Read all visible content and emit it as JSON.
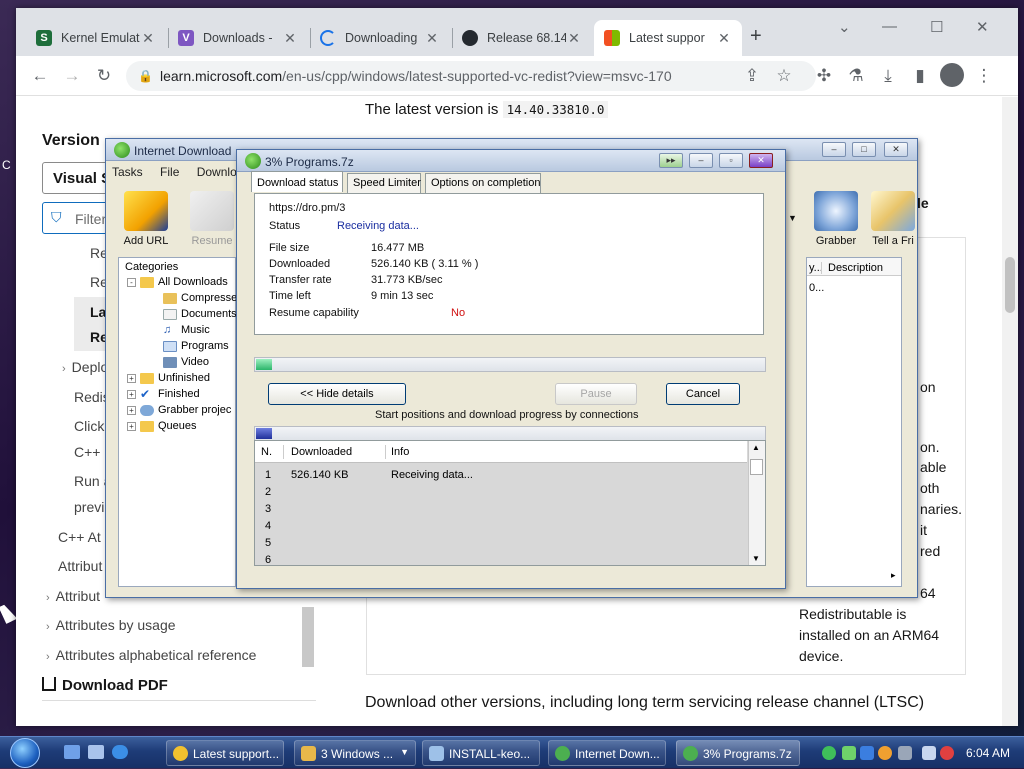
{
  "desktop": {
    "left_glyph": "C"
  },
  "browser": {
    "tabs": [
      {
        "title": "Kernel Emulat",
        "icon": "s-icon",
        "color": "#1e6e3b",
        "glyph": "S"
      },
      {
        "title": "Downloads - ",
        "icon": "vs-icon",
        "color": "#7e57c2",
        "glyph": "V"
      },
      {
        "title": "Downloading",
        "icon": "spinner-icon",
        "color": "#1a73e8",
        "glyph": ""
      },
      {
        "title": "Release 68.14",
        "icon": "github-icon",
        "color": "#24292f",
        "glyph": ""
      },
      {
        "title": "Latest suppor",
        "icon": "microsoft-icon",
        "color": "#f25022",
        "glyph": ""
      }
    ],
    "url_host": "learn.microsoft.com",
    "url_path": "/en-us/cpp/windows/latest-supported-vc-redist?view=msvc-170"
  },
  "page": {
    "latest_prefix": "The latest version is",
    "latest_version": "14.40.33810.0",
    "version_heading": "Version",
    "version_button": "Visual S",
    "filter_placeholder": "Filter",
    "nav": [
      {
        "label": "Re",
        "bold": false
      },
      {
        "label": "Re",
        "bold": false
      },
      {
        "label": "La",
        "bold": true
      },
      {
        "label": "Re",
        "bold": true
      },
      {
        "label": "Deplo",
        "bold": false,
        "chevron": true
      },
      {
        "label": "Redis",
        "bold": false
      },
      {
        "label": "ClickO",
        "bold": false
      },
      {
        "label": "C++",
        "bold": false
      },
      {
        "label": "Run a",
        "bold": false
      },
      {
        "label": "previ",
        "bold": false
      },
      {
        "label": "C++ At",
        "bold": false
      },
      {
        "label": "Attribut",
        "bold": false
      },
      {
        "label": "Attribut",
        "bold": false,
        "chevron": true
      },
      {
        "label": "Attributes by usage",
        "bold": false,
        "chevron": true
      },
      {
        "label": "Attributes alphabetical reference",
        "bold": false,
        "chevron": true
      }
    ],
    "download_pdf": "Download PDF",
    "table_heading_fragment": "table",
    "right_fragments": [
      "on",
      "on.",
      "able",
      "oth",
      "naries.",
      "it",
      "red",
      "64"
    ],
    "redist_text": [
      "Redistributable is",
      "installed on an ARM64",
      "device."
    ],
    "download_other": "Download other versions, including long term servicing release channel (LTSC)"
  },
  "idm": {
    "title": "Internet Download",
    "menu": [
      "Tasks",
      "File",
      "Downlo"
    ],
    "toolbar": [
      {
        "label": "Add URL"
      },
      {
        "label": "Resume"
      },
      {
        "label": "Grabber"
      },
      {
        "label": "Tell a Fri"
      }
    ],
    "categories_label": "Categories",
    "categories": [
      {
        "label": "All Downloads",
        "level": 0,
        "expand": "-"
      },
      {
        "label": "Compresse",
        "level": 1
      },
      {
        "label": "Documents",
        "level": 1
      },
      {
        "label": "Music",
        "level": 1
      },
      {
        "label": "Programs",
        "level": 1
      },
      {
        "label": "Video",
        "level": 1
      },
      {
        "label": "Unfinished",
        "level": 0,
        "expand": "+"
      },
      {
        "label": "Finished",
        "level": 0,
        "expand": "+"
      },
      {
        "label": "Grabber projec",
        "level": 0,
        "expand": "+"
      },
      {
        "label": "Queues",
        "level": 0,
        "expand": "+"
      }
    ],
    "list_columns": [
      "y...",
      "Description"
    ],
    "list_row_fragment": "0..."
  },
  "progress": {
    "title": "3% Programs.7z",
    "tabs": [
      "Download status",
      "Speed Limiter",
      "Options on completion"
    ],
    "url": "https://dro.pm/3",
    "status_label": "Status",
    "status_value": "Receiving data...",
    "fields": [
      {
        "label": "File size",
        "value": "16.477  MB"
      },
      {
        "label": "Downloaded",
        "value": "526.140  KB  ( 3.11 % )"
      },
      {
        "label": "Transfer rate",
        "value": "31.773  KB/sec"
      },
      {
        "label": "Time left",
        "value": "9 min 13 sec"
      }
    ],
    "resume_label": "Resume capability",
    "resume_value": "No",
    "progress_fraction": 0.0311,
    "buttons": {
      "hide": "<< Hide details",
      "pause": "Pause",
      "cancel": "Cancel"
    },
    "connections_caption": "Start positions and download progress by connections",
    "conn_columns": [
      "N.",
      "Downloaded",
      "Info"
    ],
    "conn_rows": [
      {
        "n": "1",
        "downloaded": "526.140  KB",
        "info": "Receiving data..."
      },
      {
        "n": "2",
        "downloaded": "",
        "info": ""
      },
      {
        "n": "3",
        "downloaded": "",
        "info": ""
      },
      {
        "n": "4",
        "downloaded": "",
        "info": ""
      },
      {
        "n": "5",
        "downloaded": "",
        "info": ""
      },
      {
        "n": "6",
        "downloaded": "",
        "info": ""
      }
    ]
  },
  "taskbar": {
    "tasks": [
      {
        "label": "Latest support...",
        "icon": "chrome-icon",
        "color": "#f2c12e"
      },
      {
        "label": "3 Windows ...",
        "icon": "folder-icon",
        "color": "#e8b84a"
      },
      {
        "label": "INSTALL-keo...",
        "icon": "notepad-icon",
        "color": "#9ec1e8"
      },
      {
        "label": "Internet Down...",
        "icon": "idm-icon",
        "color": "#4caf50"
      },
      {
        "label": "3% Programs.7z",
        "icon": "idm-icon",
        "color": "#4caf50"
      }
    ],
    "clock": "6:04 AM"
  }
}
